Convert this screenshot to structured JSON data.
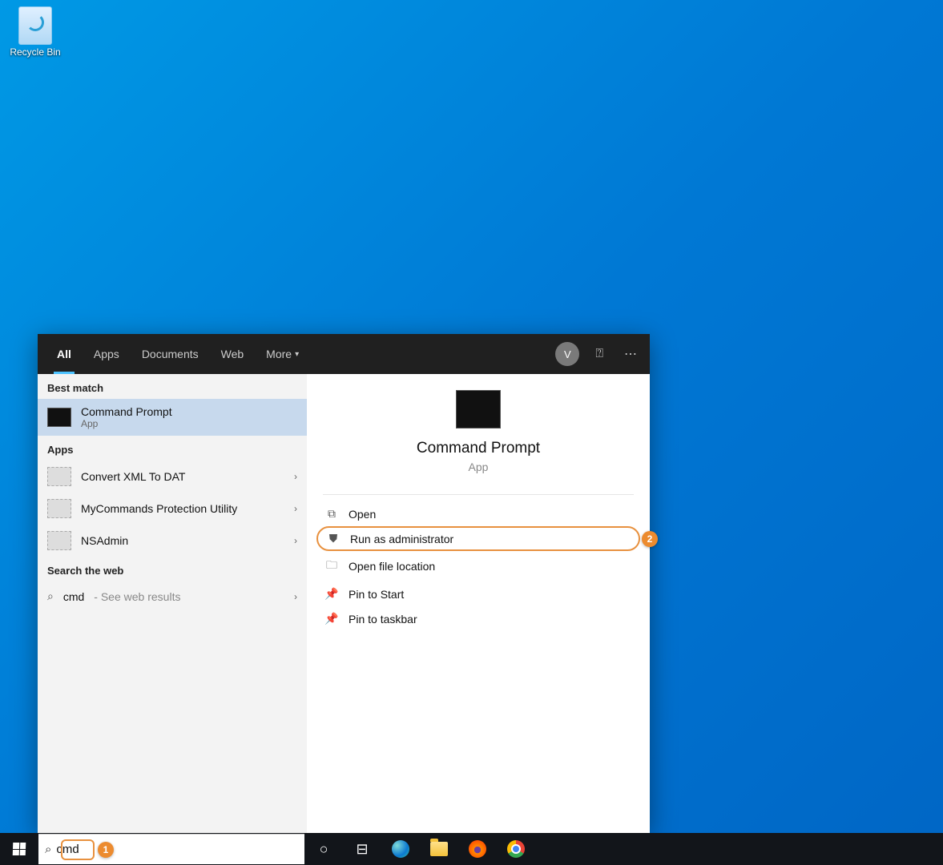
{
  "desktop": {
    "recycle_bin_label": "Recycle Bin"
  },
  "search_panel": {
    "tabs": {
      "all": "All",
      "apps": "Apps",
      "documents": "Documents",
      "web": "Web",
      "more": "More"
    },
    "avatar_initial": "V",
    "sections": {
      "best_match": "Best match",
      "apps": "Apps",
      "web": "Search the web"
    },
    "best_match": {
      "title": "Command Prompt",
      "type": "App"
    },
    "app_results": [
      {
        "title": "Convert XML To DAT"
      },
      {
        "title": "MyCommands Protection Utility"
      },
      {
        "title": "NSAdmin"
      }
    ],
    "web_query": "cmd",
    "web_suffix": " - See web results",
    "detail": {
      "title": "Command Prompt",
      "type": "App",
      "actions": {
        "open": "Open",
        "run_admin": "Run as administrator",
        "open_location": "Open file location",
        "pin_start": "Pin to Start",
        "pin_taskbar": "Pin to taskbar"
      }
    }
  },
  "taskbar": {
    "search_value": "cmd"
  },
  "annotations": {
    "badge1": "1",
    "badge2": "2"
  }
}
